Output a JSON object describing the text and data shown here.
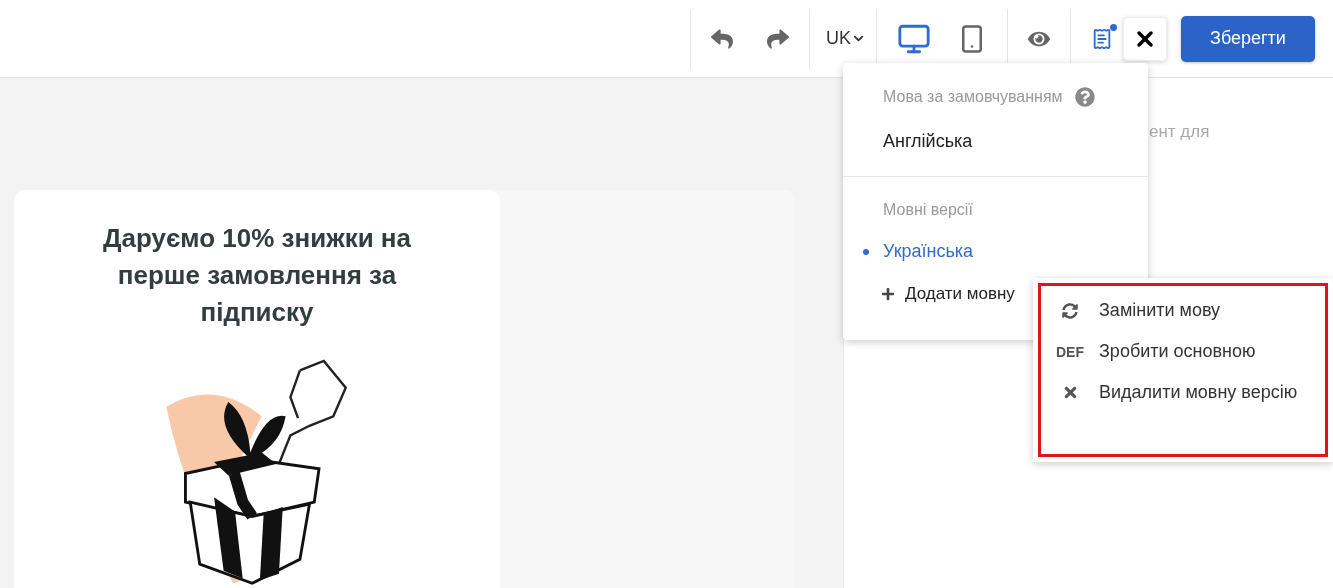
{
  "toolbar": {
    "language": "UK",
    "devices": [
      {
        "kind": "desktop",
        "selected": true
      },
      {
        "kind": "mobile",
        "selected": false
      }
    ],
    "notes_unread": true,
    "save_button": "Зберегти"
  },
  "canvas": {
    "card": {
      "title": "Даруємо 10% знижки на перше замовлення за підписку"
    }
  },
  "side_panel": {
    "text": "ент для"
  },
  "language_menu": {
    "default_label": "Мова за замовчуванням",
    "default_language": "Англійська",
    "versions_label": "Мовні версії",
    "versions": [
      {
        "label": "Українська",
        "selected": true
      }
    ],
    "add_label": "Додати мовну"
  },
  "context_menu": {
    "highlighted": true,
    "items": [
      {
        "kind": "replace",
        "label": "Замінити мову"
      },
      {
        "kind": "default",
        "icon_text": "DEF",
        "label": "Зробити основною"
      },
      {
        "kind": "delete",
        "label": "Видалити мовну версію"
      }
    ]
  }
}
